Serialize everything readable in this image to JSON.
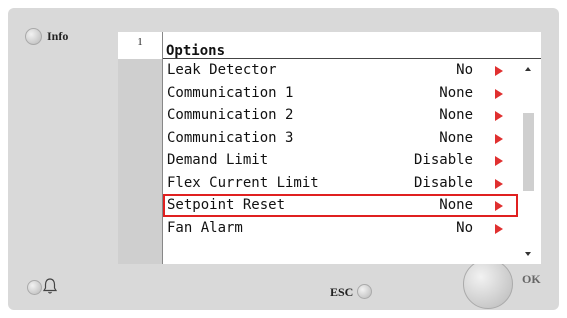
{
  "panel": {
    "info_label": "Info",
    "esc_label": "ESC",
    "ok_label": "OK"
  },
  "screen": {
    "line_number": "1",
    "title": "Options",
    "rows": [
      {
        "label": "Leak Detector",
        "value": "No"
      },
      {
        "label": "Communication 1",
        "value": "None"
      },
      {
        "label": "Communication 2",
        "value": "None"
      },
      {
        "label": "Communication 3",
        "value": "None"
      },
      {
        "label": "Demand Limit",
        "value": "Disable"
      },
      {
        "label": "Flex Current Limit",
        "value": "Disable"
      },
      {
        "label": "Setpoint Reset",
        "value": "None"
      },
      {
        "label": "Fan Alarm",
        "value": "No"
      }
    ],
    "highlighted_row": 6
  },
  "icons": {
    "bell": "bell-icon",
    "arrow": "arrow-right-icon"
  },
  "colors": {
    "highlight": "#e02020",
    "arrow": "#e03030"
  }
}
